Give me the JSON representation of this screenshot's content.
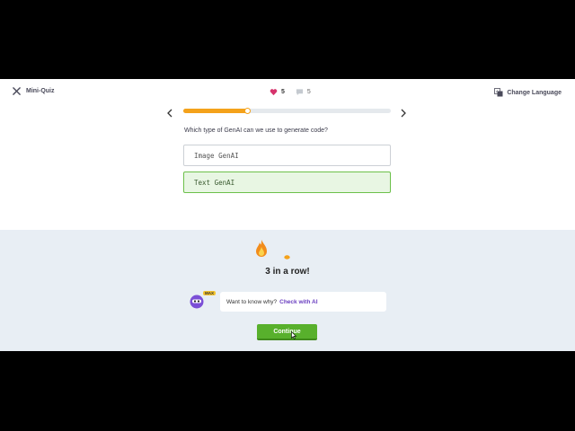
{
  "header": {
    "close_label": "Mini-Quiz",
    "hearts": "5",
    "comments": "5",
    "change_language_label": "Change Language"
  },
  "progress": {
    "value": 0.31
  },
  "quiz": {
    "question": "Which type of GenAI can we use to generate code?",
    "options": [
      {
        "label": "Image GenAI",
        "state": "default"
      },
      {
        "label": "Text GenAI",
        "state": "correct"
      }
    ]
  },
  "feedback": {
    "streak_text": "3 in a row!",
    "avatar_badge": "MAX",
    "hint_text": "Want to know why?",
    "hint_link": "Check with AI",
    "continue_label": "Continue"
  },
  "colors": {
    "progress": "#f4a21b",
    "correct_bg": "#e8f6e3",
    "correct_border": "#6cc04a",
    "continue_bg": "#58b02c",
    "link": "#6a3fc0",
    "heart": "#d6336c"
  }
}
